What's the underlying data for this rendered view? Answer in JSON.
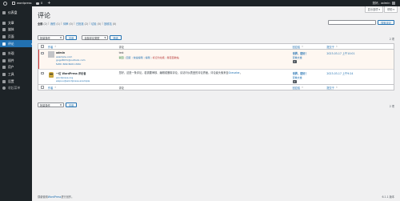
{
  "adminbar": {
    "site_name": "wordpress",
    "comments_count": "0",
    "new_label": "+",
    "greeting": "您好，admin"
  },
  "sidebar": {
    "items": [
      {
        "label": "仪表盘",
        "icon": "dashboard-icon"
      },
      {
        "label": "文章",
        "icon": "pin-icon"
      },
      {
        "label": "媒体",
        "icon": "media-icon"
      },
      {
        "label": "页面",
        "icon": "page-icon"
      },
      {
        "label": "评论",
        "icon": "comment-icon",
        "current": true
      },
      {
        "label": "外观",
        "icon": "brush-icon"
      },
      {
        "label": "插件",
        "icon": "plugin-icon"
      },
      {
        "label": "用户",
        "icon": "user-icon"
      },
      {
        "label": "工具",
        "icon": "wrench-icon"
      },
      {
        "label": "设置",
        "icon": "settings-icon"
      }
    ],
    "collapse_label": "收起菜单"
  },
  "screen_tabs": {
    "options": "显示选项",
    "help": "帮助"
  },
  "page": {
    "title": "评论"
  },
  "filters": [
    {
      "label": "全部",
      "count": "(2)",
      "current": true
    },
    {
      "label": "我的",
      "count": "(1)"
    },
    {
      "label": "待审",
      "count": "(0)"
    },
    {
      "label": "已批准",
      "count": "(2)"
    },
    {
      "label": "垃圾",
      "count": "(0)"
    },
    {
      "label": "回收站",
      "count": "(0)"
    }
  ],
  "search": {
    "button": "搜索评论"
  },
  "tablenav": {
    "bulk_label": "批量操作",
    "apply": "应用",
    "type_label": "全部评论类型",
    "filter": "筛选",
    "items_count": "2 项"
  },
  "table": {
    "headers": {
      "author": "作者",
      "comment": "评论",
      "response": "回应给",
      "date": "提交于"
    },
    "rows": [
      {
        "author_name": "admin",
        "author_url": "example.com",
        "author_email": "gogo8031@outlook.com",
        "author_ip": "fe80::6b9:6b61:2b6c",
        "comment": "test",
        "actions": {
          "approve": "驳回",
          "reply": "回复",
          "quick_edit": "快速编辑",
          "edit": "编辑",
          "spam": "标记为垃圾",
          "trash": "移至回收站"
        },
        "response_title": "世界，您好！",
        "response_view": "查看文章",
        "response_count": "2",
        "date": "2023-03-17 上午10:01"
      },
      {
        "author_name": "一位 WordPress 评论者",
        "author_url": "wordpress.org",
        "author_email": "wapuu@wordpress.example",
        "comment": "您好，这是一条评论。若需要审核、编辑或删除评论，请访问仪表盘的评论界面。评论者头像来自",
        "comment_link": "Gravatar",
        "comment_end": "。",
        "response_title": "世界，您好！",
        "response_view": "查看文章",
        "response_count": "2",
        "date": "2023-03-17 上午9:24"
      }
    ]
  },
  "footer": {
    "thanks_pre": "感谢使用",
    "thanks_link": "WordPress",
    "thanks_post": "进行创作。",
    "version": "6.1.1 版本"
  }
}
